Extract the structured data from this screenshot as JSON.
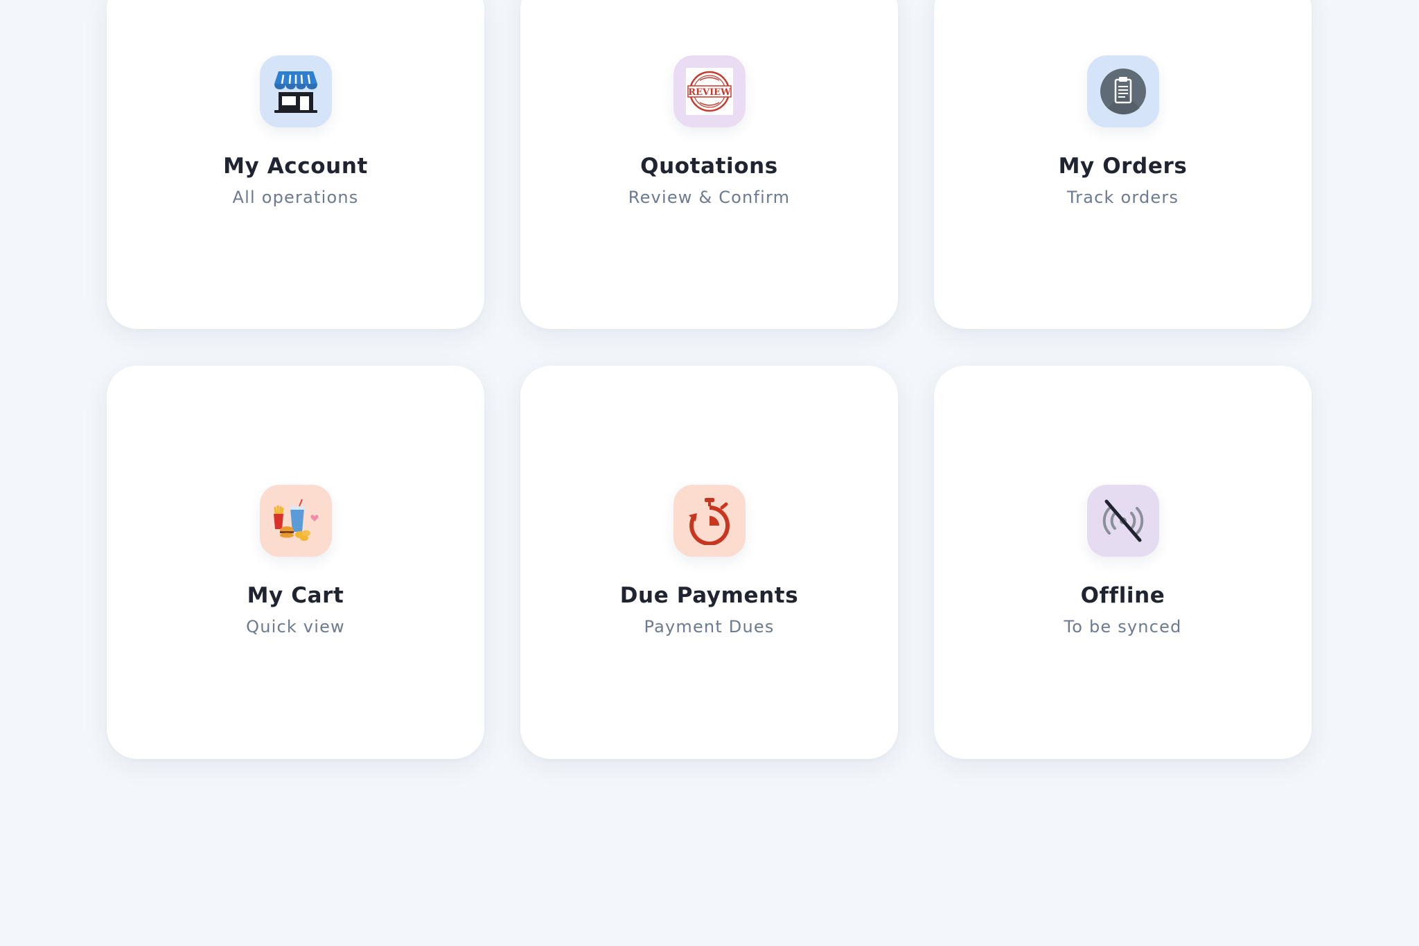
{
  "tiles": [
    {
      "title": "My Account",
      "subtitle": "All operations",
      "icon": "store-icon",
      "tile_color": "#d5e4f8"
    },
    {
      "title": "Quotations",
      "subtitle": "Review & Confirm",
      "icon": "review-stamp-icon",
      "tile_color": "#eadcf3",
      "icon_text": "REVIEW"
    },
    {
      "title": "My Orders",
      "subtitle": "Track orders",
      "icon": "clipboard-icon",
      "tile_color": "#d5e4f8"
    },
    {
      "title": "My Cart",
      "subtitle": "Quick view",
      "icon": "fast-food-icon",
      "tile_color": "#fbdccf"
    },
    {
      "title": "Due Payments",
      "subtitle": "Payment Dues",
      "icon": "stopwatch-icon",
      "tile_color": "#fbdccf"
    },
    {
      "title": "Offline",
      "subtitle": "To be synced",
      "icon": "no-signal-icon",
      "tile_color": "#e6dcf2"
    }
  ]
}
